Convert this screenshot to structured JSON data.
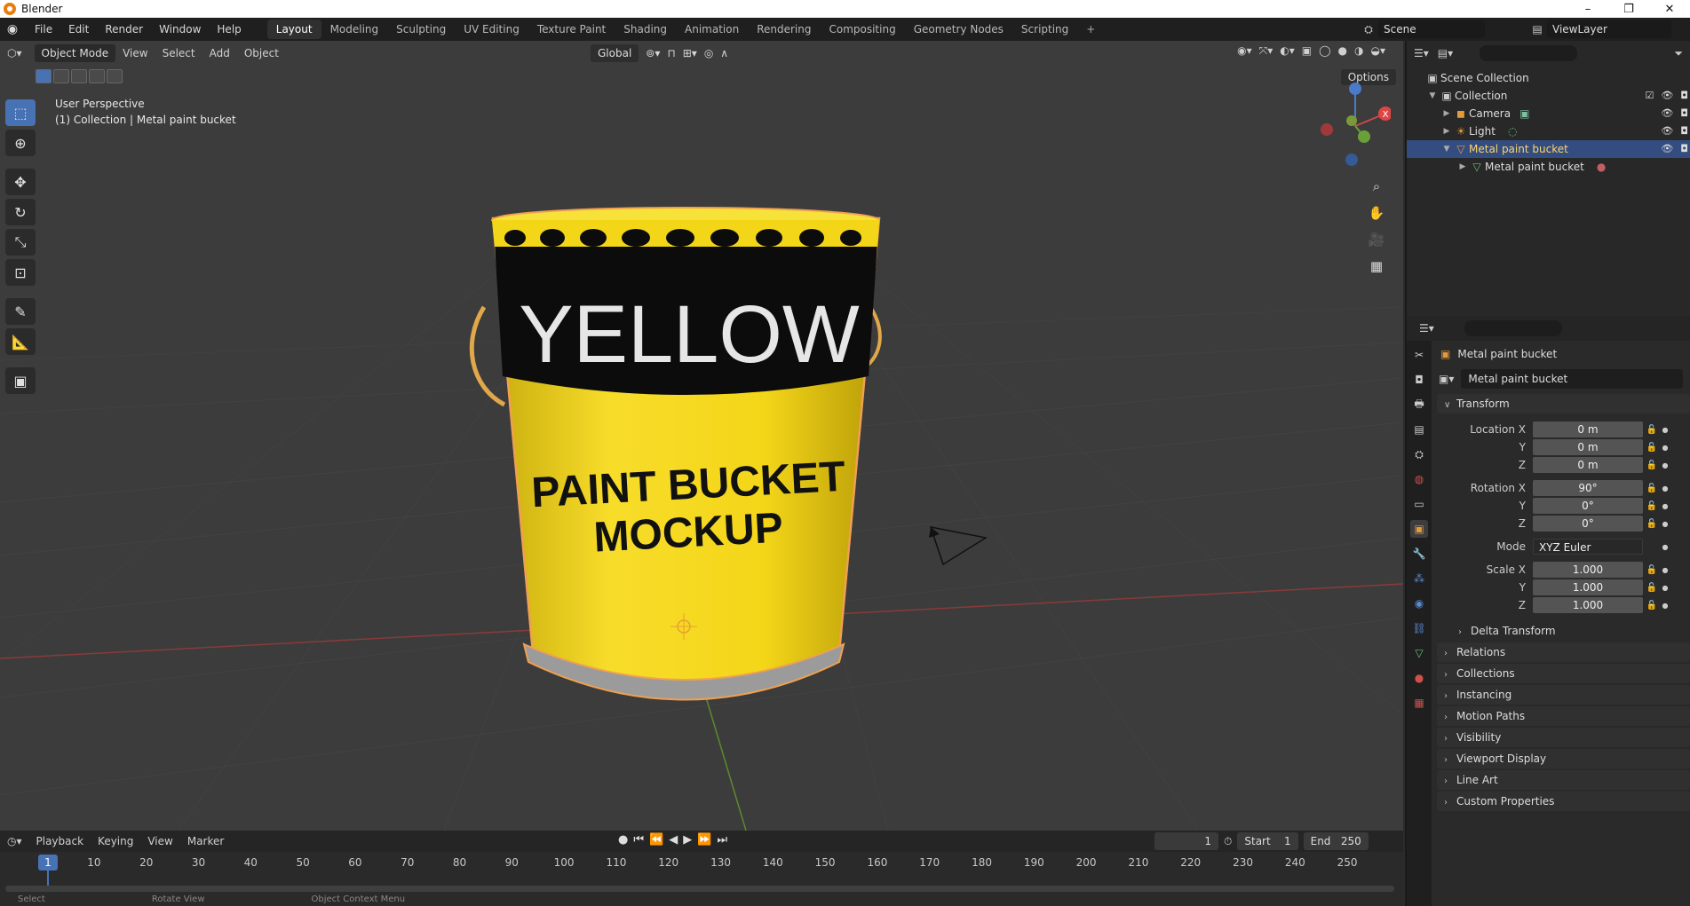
{
  "window": {
    "title": "Blender",
    "controls": [
      "–",
      "❐",
      "✕"
    ]
  },
  "menu": [
    "File",
    "Edit",
    "Render",
    "Window",
    "Help"
  ],
  "workspaces": [
    {
      "label": "Layout",
      "active": true
    },
    {
      "label": "Modeling"
    },
    {
      "label": "Sculpting"
    },
    {
      "label": "UV Editing"
    },
    {
      "label": "Texture Paint"
    },
    {
      "label": "Shading"
    },
    {
      "label": "Animation"
    },
    {
      "label": "Rendering"
    },
    {
      "label": "Compositing"
    },
    {
      "label": "Geometry Nodes"
    },
    {
      "label": "Scripting"
    }
  ],
  "workspace_add": "+",
  "scene": {
    "name": "Scene"
  },
  "view_layer": {
    "name": "ViewLayer"
  },
  "viewport": {
    "mode": "Object Mode",
    "menus": [
      "View",
      "Select",
      "Add",
      "Object"
    ],
    "orientation": "Global",
    "options_label": "Options",
    "overlay_line1": "User Perspective",
    "overlay_line2": "(1) Collection | Metal paint bucket"
  },
  "bucket": {
    "band_text": "YELLOW",
    "label_line1": "PAINT BUCKET",
    "label_line2": "MOCKUP",
    "color_yellow": "#f2d314",
    "color_band": "#0c0c0c"
  },
  "outliner": {
    "root": "Scene Collection",
    "items": [
      {
        "label": "Collection",
        "icon": "collection-icon"
      },
      {
        "label": "Camera",
        "icon": "camera-icon"
      },
      {
        "label": "Light",
        "icon": "light-icon"
      },
      {
        "label": "Metal paint bucket",
        "icon": "mesh-object-icon",
        "selected": true
      },
      {
        "label": "Metal paint bucket",
        "icon": "mesh-data-icon"
      }
    ]
  },
  "properties": {
    "object_name": "Metal paint bucket",
    "object_field": "Metal paint bucket",
    "transform_title": "Transform",
    "location": {
      "label_x": "Location X",
      "label_y": "Y",
      "label_z": "Z",
      "x": "0 m",
      "y": "0 m",
      "z": "0 m"
    },
    "rotation": {
      "label_x": "Rotation X",
      "label_y": "Y",
      "label_z": "Z",
      "x": "90°",
      "y": "0°",
      "z": "0°"
    },
    "mode": {
      "label": "Mode",
      "value": "XYZ Euler"
    },
    "scale": {
      "label_x": "Scale X",
      "label_y": "Y",
      "label_z": "Z",
      "x": "1.000",
      "y": "1.000",
      "z": "1.000"
    },
    "delta_transform": "Delta Transform",
    "panels": [
      "Relations",
      "Collections",
      "Instancing",
      "Motion Paths",
      "Visibility",
      "Viewport Display",
      "Line Art",
      "Custom Properties"
    ]
  },
  "timeline": {
    "menus": [
      "Playback",
      "Keying",
      "View",
      "Marker"
    ],
    "current_frame": "1",
    "start_label": "Start",
    "start": "1",
    "end_label": "End",
    "end": "250",
    "ticks": [
      "10",
      "20",
      "30",
      "40",
      "50",
      "60",
      "70",
      "80",
      "90",
      "100",
      "110",
      "120",
      "130",
      "140",
      "150",
      "160",
      "170",
      "180",
      "190",
      "200",
      "210",
      "220",
      "230",
      "240",
      "250"
    ],
    "playhead_frame": "1"
  },
  "status": [
    "Select",
    "Rotate View",
    "Object Context Menu"
  ]
}
